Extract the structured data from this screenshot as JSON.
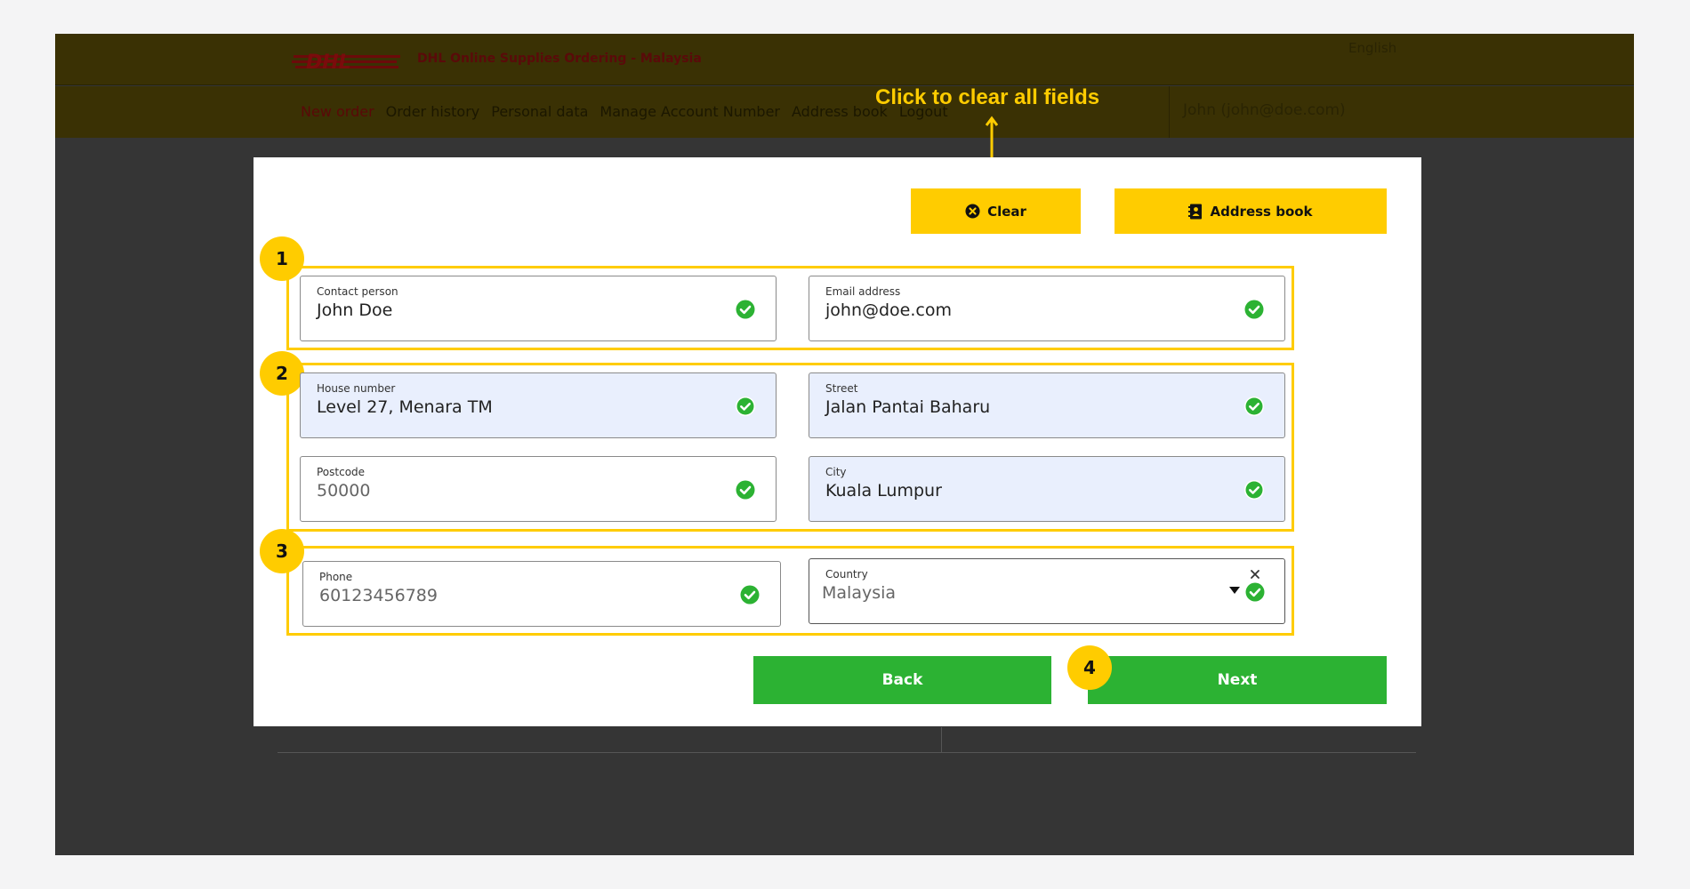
{
  "header": {
    "logo_icon": "dhl-logo-icon",
    "app_title": "DHL Online Supplies Ordering - Malaysia",
    "language": "English",
    "nav": [
      {
        "label": "New order",
        "active": true
      },
      {
        "label": "Order history"
      },
      {
        "label": "Personal data"
      },
      {
        "label": "Manage Account Number"
      },
      {
        "label": "Address book"
      },
      {
        "label": "Logout"
      }
    ],
    "user": "John (john@doe.com)"
  },
  "annotation": {
    "callout": "Click to clear all fields",
    "badges": [
      "1",
      "2",
      "3",
      "4"
    ],
    "color": "#ffcc00"
  },
  "toolbar": {
    "clear_label": "Clear",
    "clear_icon": "close-circle-icon",
    "address_book_label": "Address book",
    "address_book_icon": "address-book-icon"
  },
  "form": {
    "contact_person": {
      "label": "Contact person",
      "value": "John Doe"
    },
    "email": {
      "label": "Email address",
      "value": "john@doe.com"
    },
    "house_number": {
      "label": "House number",
      "value": "Level 27, Menara TM"
    },
    "street": {
      "label": "Street",
      "value": "Jalan Pantai Baharu"
    },
    "postcode": {
      "label": "Postcode",
      "value": "50000"
    },
    "city": {
      "label": "City",
      "value": "Kuala Lumpur"
    },
    "phone": {
      "label": "Phone",
      "value": "60123456789"
    },
    "country": {
      "label": "Country",
      "value": "Malaysia"
    },
    "valid_icon": "check-circle-icon",
    "valid_color": "#2cb233"
  },
  "actions": {
    "back_label": "Back",
    "next_label": "Next"
  },
  "colors": {
    "accent": "#ffcc00",
    "primary_button": "#2cb233",
    "brand_red": "#d40511"
  }
}
